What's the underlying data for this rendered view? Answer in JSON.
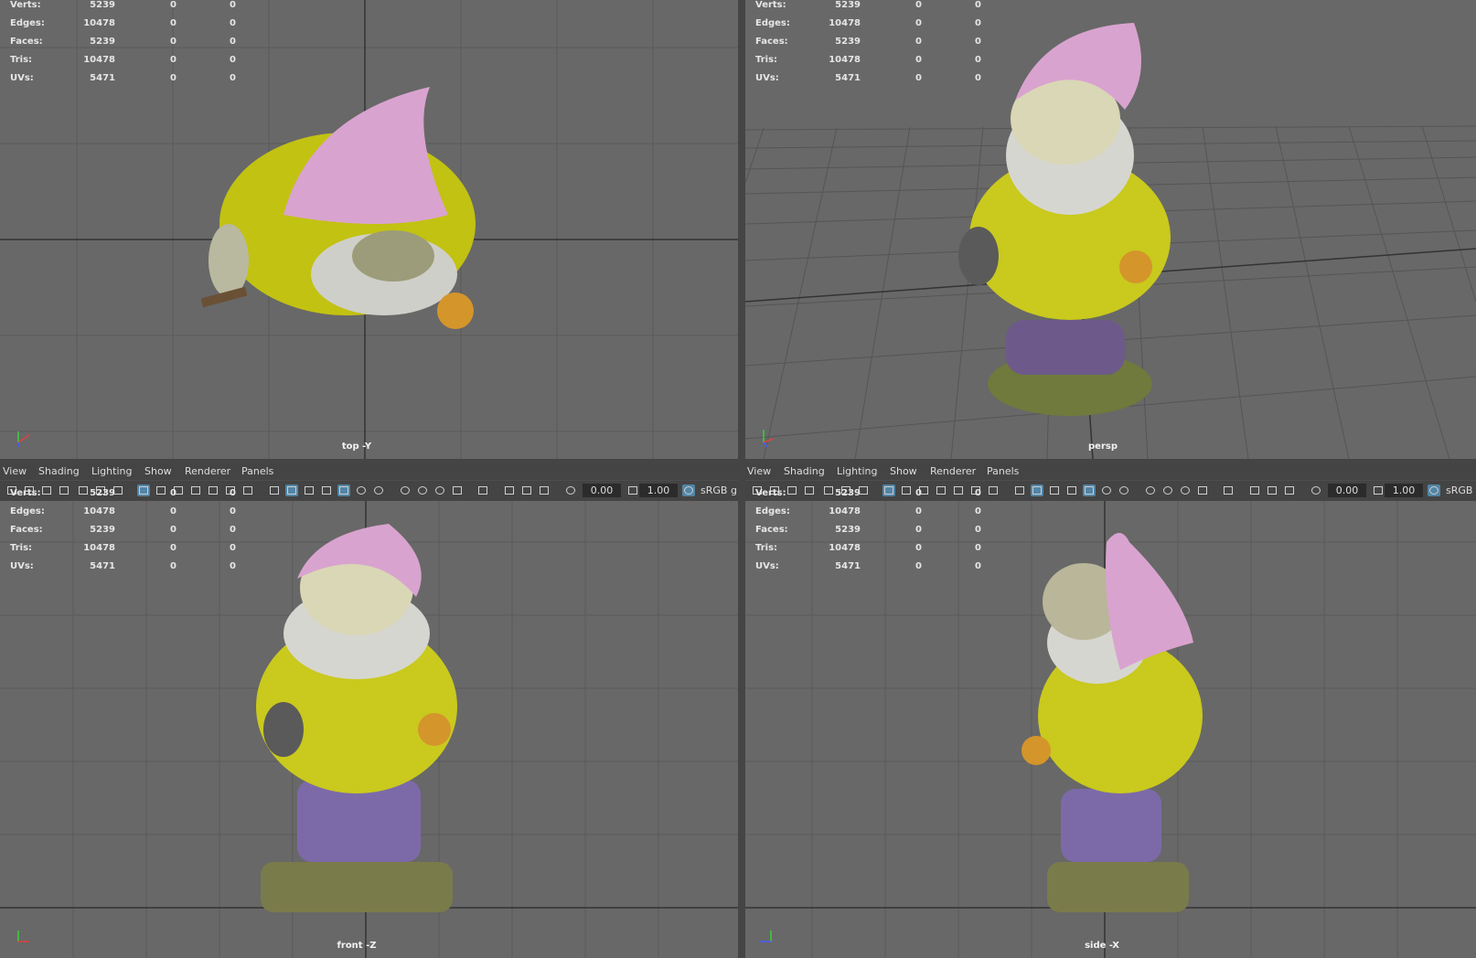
{
  "stats": [
    {
      "label": "Verts:",
      "v1": "5239",
      "v2": "0",
      "v3": "0"
    },
    {
      "label": "Edges:",
      "v1": "10478",
      "v2": "0",
      "v3": "0"
    },
    {
      "label": "Faces:",
      "v1": "5239",
      "v2": "0",
      "v3": "0"
    },
    {
      "label": "Tris:",
      "v1": "10478",
      "v2": "0",
      "v3": "0"
    },
    {
      "label": "UVs:",
      "v1": "5471",
      "v2": "0",
      "v3": "0"
    }
  ],
  "viewports": {
    "top": {
      "camera": "top -Y"
    },
    "persp": {
      "camera": "persp"
    },
    "front": {
      "camera": "front -Z"
    },
    "side": {
      "camera": "side -X"
    }
  },
  "menu": {
    "view": "View",
    "shading": "Shading",
    "lighting": "Lighting",
    "show": "Show",
    "renderer": "Renderer",
    "panels": "Panels"
  },
  "toolbar": {
    "exposure": "0.00",
    "gamma": "1.00",
    "colorspace": "sRGB g",
    "colorspace_right": "sRGB"
  },
  "colors": {
    "viewport_bg": "#686868",
    "panel_bg": "#444444",
    "accent": "#5285a6",
    "hat": "#d9a3cf",
    "jacket": "#c9c91e",
    "pants": "#7c6aa8"
  },
  "icons": [
    "camera-icon",
    "grid-icon",
    "shaded-icon",
    "xray-icon",
    "light-icon",
    "exposure-icon",
    "gamma-icon"
  ]
}
